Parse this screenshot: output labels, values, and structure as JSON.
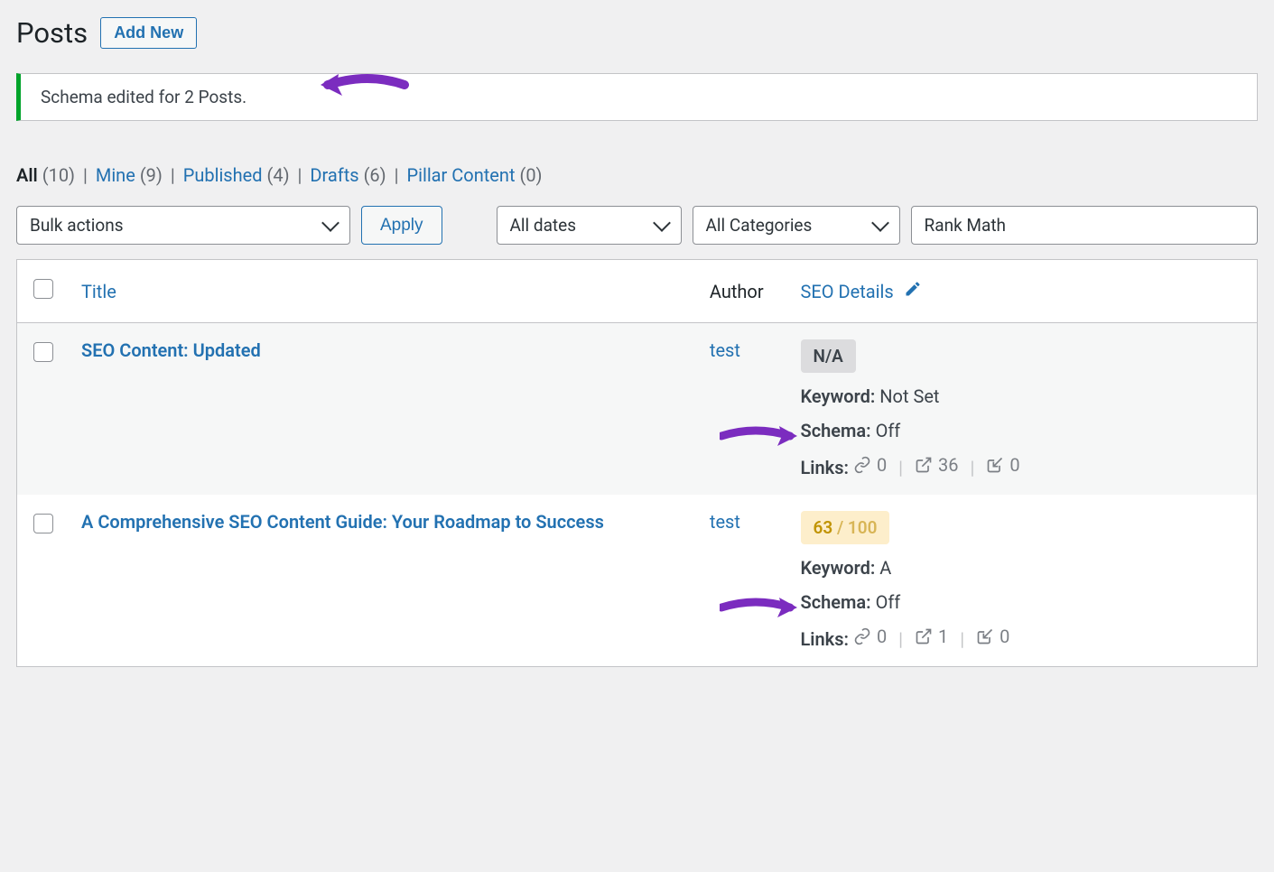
{
  "header": {
    "title": "Posts",
    "add_new": "Add New"
  },
  "notice": "Schema edited for 2 Posts.",
  "filters": {
    "all_label": "All",
    "all_count": "(10)",
    "mine_label": "Mine",
    "mine_count": "(9)",
    "published_label": "Published",
    "published_count": "(4)",
    "drafts_label": "Drafts",
    "drafts_count": "(6)",
    "pillar_label": "Pillar Content",
    "pillar_count": "(0)"
  },
  "controls": {
    "bulk": "Bulk actions",
    "apply": "Apply",
    "dates": "All dates",
    "categories": "All Categories",
    "rankmath": "Rank Math"
  },
  "table": {
    "columns": {
      "title": "Title",
      "author": "Author",
      "seo": "SEO Details"
    }
  },
  "rows": [
    {
      "title": "SEO Content: Updated",
      "author": "test",
      "score_type": "na",
      "score_text": "N/A",
      "keyword_label": "Keyword:",
      "keyword_value": "Not Set",
      "schema_label": "Schema:",
      "schema_value": "Off",
      "links_label": "Links:",
      "links_internal": "0",
      "links_external": "36",
      "links_incoming": "0"
    },
    {
      "title": "A Comprehensive SEO Content Guide: Your Roadmap to Success",
      "author": "test",
      "score_type": "score-good",
      "score_text": "63",
      "score_denom": " / 100",
      "keyword_label": "Keyword:",
      "keyword_value": "A",
      "schema_label": "Schema:",
      "schema_value": "Off",
      "links_label": "Links:",
      "links_internal": "0",
      "links_external": "1",
      "links_incoming": "0"
    }
  ]
}
